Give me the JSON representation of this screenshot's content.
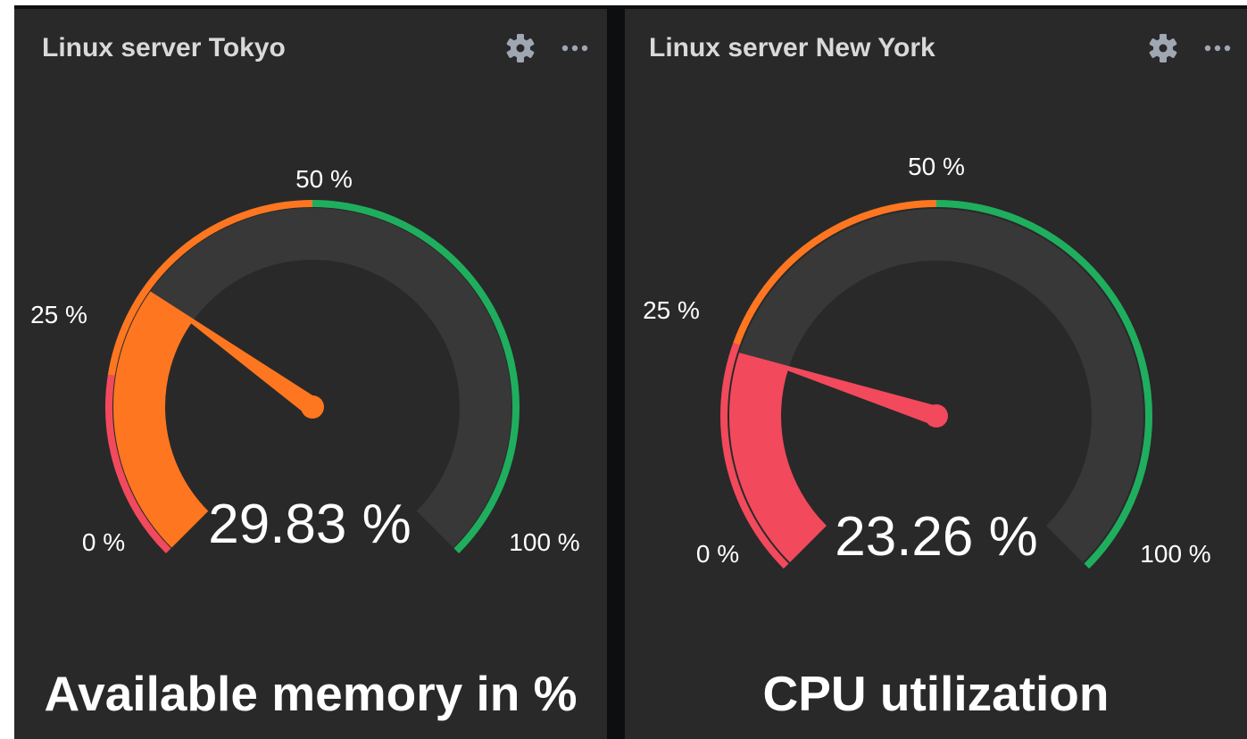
{
  "colors": {
    "panel_bg": "#292929",
    "gauge_track": "#383838",
    "red": "#f2495c",
    "orange": "#ff7620",
    "green": "#1fae5e",
    "text": "#ffffff",
    "title_text": "#d8d9da",
    "icon": "#9fa7b3"
  },
  "panels": [
    {
      "title": "Linux server Tokyo",
      "icons": [
        "gear-icon",
        "ellipsis-icon"
      ],
      "gauge": {
        "value": 29.83,
        "min": 0,
        "max": 100,
        "value_text": "29.83 %",
        "ticks": [
          "0 %",
          "25 %",
          "50 %",
          "100 %"
        ],
        "thresholds": [
          {
            "from": 0,
            "to": 20,
            "color": "red"
          },
          {
            "from": 20,
            "to": 50,
            "color": "orange"
          },
          {
            "from": 50,
            "to": 100,
            "color": "green"
          }
        ]
      },
      "label": "Available memory in %"
    },
    {
      "title": "Linux server New York",
      "icons": [
        "gear-icon",
        "ellipsis-icon"
      ],
      "gauge": {
        "value": 23.26,
        "min": 0,
        "max": 100,
        "value_text": "23.26 %",
        "ticks": [
          "0 %",
          "25 %",
          "50 %",
          "100 %"
        ],
        "thresholds": [
          {
            "from": 0,
            "to": 24,
            "color": "red"
          },
          {
            "from": 24,
            "to": 50,
            "color": "orange"
          },
          {
            "from": 50,
            "to": 100,
            "color": "green"
          }
        ]
      },
      "label": "CPU utilization"
    }
  ]
}
